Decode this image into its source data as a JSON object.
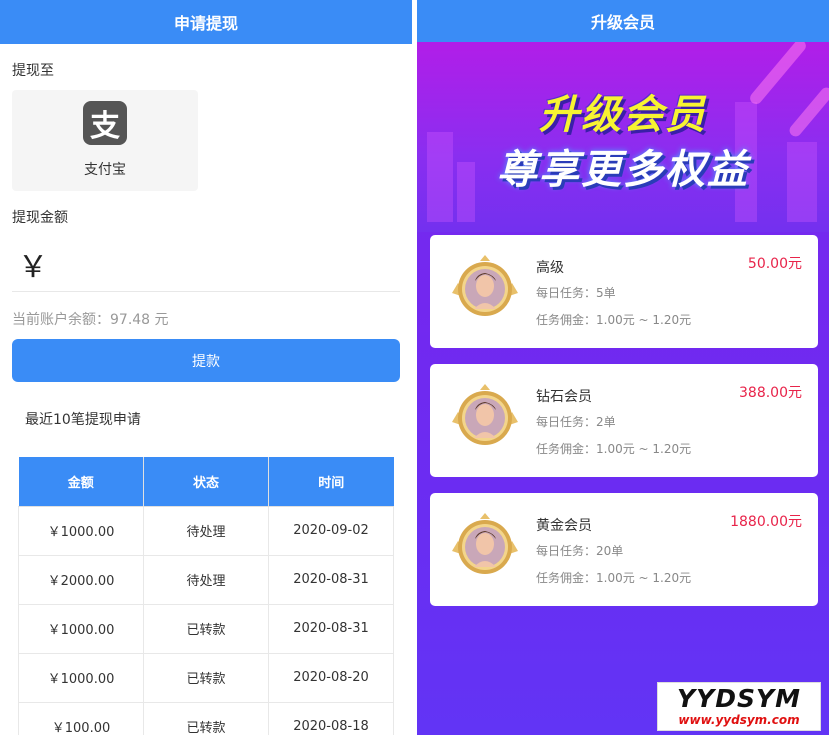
{
  "withdraw": {
    "title": "申请提现",
    "to_label": "提现至",
    "method": {
      "name": "支付宝",
      "icon": "alipay-icon",
      "glyph": "支"
    },
    "amount_label": "提现金额",
    "currency": "￥",
    "amount_value": "",
    "balance_text": "当前账户余额：97.48 元",
    "submit_label": "提款",
    "recent_title": "最近10笔提现申请",
    "table": {
      "headers": [
        "金额",
        "状态",
        "时间"
      ],
      "rows": [
        [
          "￥1000.00",
          "待处理",
          "2020-09-02"
        ],
        [
          "￥2000.00",
          "待处理",
          "2020-08-31"
        ],
        [
          "￥1000.00",
          "已转款",
          "2020-08-31"
        ],
        [
          "￥1000.00",
          "已转款",
          "2020-08-20"
        ],
        [
          "￥100.00",
          "已转款",
          "2020-08-18"
        ]
      ]
    }
  },
  "upgrade": {
    "title": "升级会员",
    "banner_line1": "升级会员",
    "banner_line2": "尊享更多权益",
    "plans": [
      {
        "name": "高级",
        "price": "50.00元",
        "tasks": "每日任务：5单",
        "commission": "任务佣金：1.00元 ~ 1.20元"
      },
      {
        "name": "钻石会员",
        "price": "388.00元",
        "tasks": "每日任务：2单",
        "commission": "任务佣金：1.00元 ~ 1.20元"
      },
      {
        "name": "黄金会员",
        "price": "1880.00元",
        "tasks": "每日任务：20单",
        "commission": "任务佣金：1.00元 ~ 1.20元"
      }
    ]
  },
  "watermark": {
    "brand": "YYDSYM",
    "url": "www.yydsym.com"
  },
  "colors": {
    "primary": "#3a8cf6",
    "price": "#e8244a",
    "purple": "#7a2ff0",
    "banner_yellow": "#f7f431"
  }
}
